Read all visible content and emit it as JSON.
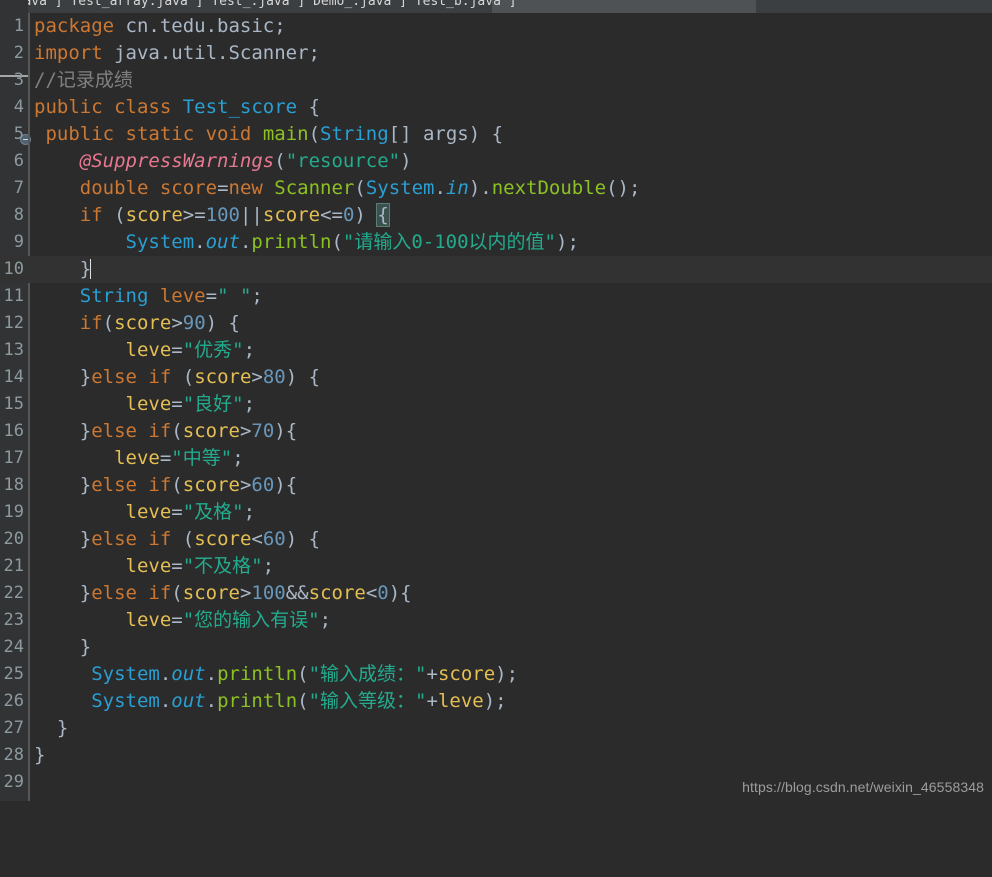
{
  "window": {
    "app": "Eclipse IDE Java Editor",
    "theme_background": "#2b2b2b",
    "gutter_background": "#313335",
    "current_line_background": "#323232",
    "accent_keyword": "#cc7832",
    "accent_string": "#23ab8e",
    "accent_class": "#299fd3",
    "accent_method": "#8cc122",
    "accent_number": "#6897bb",
    "accent_field": "#e5bf53",
    "accent_annotation": "#e8788f",
    "accent_comment": "#808080"
  },
  "tabbar": {
    "visible": "partially-cropped",
    "glyph_row": "_.java  ]  Test_array.java  ]  Test_.java  ]  Demo_.java  ]  Test_b.java  ]"
  },
  "editor": {
    "language": "Java",
    "caret_line": 10,
    "fold_marker_line": 5,
    "total_visible_lines": 29,
    "lines": [
      {
        "n": "1",
        "text": "package cn.tedu.basic;"
      },
      {
        "n": "2",
        "text": "import java.util.Scanner;"
      },
      {
        "n": "3",
        "text": "//记录成绩"
      },
      {
        "n": "4",
        "text": "public class Test_score {"
      },
      {
        "n": "5",
        "text": " public static void main(String[] args) {"
      },
      {
        "n": "6",
        "text": "    @SuppressWarnings(\"resource\")"
      },
      {
        "n": "7",
        "text": "    double score=new Scanner(System.in).nextDouble();"
      },
      {
        "n": "8",
        "text": "    if (score>=100||score<=0) {"
      },
      {
        "n": "9",
        "text": "        System.out.println(\"请输入0-100以内的值\");"
      },
      {
        "n": "10",
        "text": "    }"
      },
      {
        "n": "11",
        "text": "    String leve=\" \";"
      },
      {
        "n": "12",
        "text": "    if(score>90) {"
      },
      {
        "n": "13",
        "text": "        leve=\"优秀\";"
      },
      {
        "n": "14",
        "text": "    }else if (score>80) {"
      },
      {
        "n": "15",
        "text": "        leve=\"良好\";"
      },
      {
        "n": "16",
        "text": "    }else if(score>70){"
      },
      {
        "n": "17",
        "text": "        leve=\"中等\";"
      },
      {
        "n": "18",
        "text": "    }else if(score>60){"
      },
      {
        "n": "19",
        "text": "        leve=\"及格\";"
      },
      {
        "n": "20",
        "text": "    }else if (score<60) {"
      },
      {
        "n": "21",
        "text": "        leve=\"不及格\";"
      },
      {
        "n": "22",
        "text": "    }else if(score>100&&score<0){"
      },
      {
        "n": "23",
        "text": "        leve=\"您的输入有误\";"
      },
      {
        "n": "24",
        "text": "    }"
      },
      {
        "n": "25",
        "text": "     System.out.println(\"输入成绩：\"+score);"
      },
      {
        "n": "26",
        "text": "     System.out.println(\"输入等级：\"+leve);"
      },
      {
        "n": "27",
        "text": "  }"
      },
      {
        "n": "28",
        "text": "}"
      },
      {
        "n": "29",
        "text": ""
      }
    ]
  },
  "watermark": {
    "text": "https://blog.csdn.net/weixin_46558348"
  }
}
